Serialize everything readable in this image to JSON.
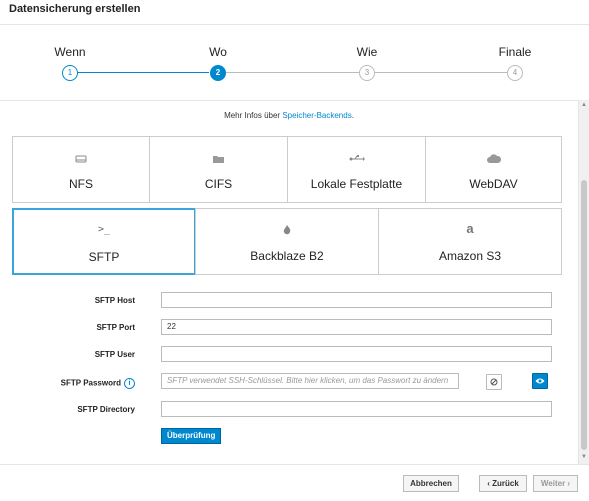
{
  "header": {
    "title": "Datensicherung erstellen"
  },
  "wizard": {
    "steps": [
      {
        "label": "Wenn",
        "number": "1",
        "state": "done"
      },
      {
        "label": "Wo",
        "number": "2",
        "state": "active"
      },
      {
        "label": "Wie",
        "number": "3",
        "state": "pending"
      },
      {
        "label": "Finale",
        "number": "4",
        "state": "pending"
      }
    ]
  },
  "content": {
    "info_prefix": "Mehr Infos über",
    "info_link": "Speicher-Backends",
    "info_suffix": ".",
    "backends_row1": [
      {
        "label": "NFS",
        "icon": "drive-icon"
      },
      {
        "label": "CIFS",
        "icon": "folder-icon"
      },
      {
        "label": "Lokale Festplatte",
        "icon": "usb-icon"
      },
      {
        "label": "WebDAV",
        "icon": "cloud-icon"
      }
    ],
    "backends_row2": [
      {
        "label": "SFTP",
        "icon": "terminal-icon",
        "selected": true
      },
      {
        "label": "Backblaze B2",
        "icon": "flame-icon",
        "selected": false
      },
      {
        "label": "Amazon S3",
        "icon": "amazon-icon",
        "selected": false
      }
    ],
    "form": {
      "host_label": "SFTP Host",
      "host_value": "",
      "port_label": "SFTP Port",
      "port_value": "22",
      "user_label": "SFTP User",
      "user_value": "",
      "password_label": "SFTP Password",
      "password_placeholder": "SFTP verwendet SSH-Schlüssel. Bitte hier klicken, um das Passwort zu ändern",
      "directory_label": "SFTP Directory",
      "directory_value": "",
      "check_button": "Überprüfung"
    }
  },
  "footer": {
    "cancel": "Abbrechen",
    "back": "‹ Zurück",
    "next": "Weiter ›"
  },
  "colors": {
    "accent": "#0088ce",
    "accent_border": "#00659c",
    "selected_border": "#39a5dc"
  }
}
